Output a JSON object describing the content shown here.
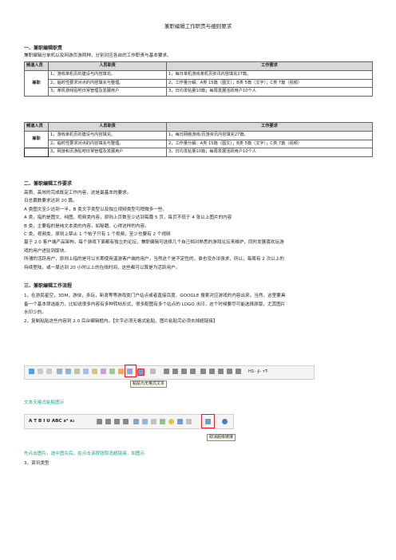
{
  "doc_title": "兼职编辑工作职责与细则要求",
  "s1": {
    "heading": "一、兼职编辑职责",
    "intro": "兼职编辑分单机以及网游页游两种，分别对应各自的工作职责与基本要求。",
    "table1": {
      "col1": "频道人员",
      "col2": "人员职责",
      "col3": "工作要求",
      "label": "兼职",
      "duties": [
        "1，游戏单机页的建设与内容填充。",
        "2，临时性要求对点的内容填充与整理。",
        "3，单机游戏贴吧日常管理及发展用户"
      ],
      "reqs": [
        "1，每日单机游戏单机页资讯内容填充27篇。",
        "2，工作量分解：A类 15篇（图文）；B类 5篇（文字）；C类 7篇（视频）",
        "3，日均发帖量10篇；每周发展活跃用户10个人"
      ]
    },
    "table2": {
      "col1": "频道人员",
      "col2": "人员职责",
      "col3": "工作要求",
      "label": "兼职",
      "duties": [
        "1，游戏单机页的建设与内容填充。",
        "2，临时性要求对点的内容填充与整理。",
        "3，网游和页游贴吧日常管理及发展用户"
      ],
      "reqs": [
        "1，每日网络游戏/页游资讯内容填充27篇。",
        "2，工作量分解：A类 15篇（图文）；B类 5篇（文字）；C类 7篇（视频）",
        "3，日均发帖量10篇；每周发展活跃用户10个人"
      ]
    }
  },
  "s2": {
    "heading": "二、兼职编辑工作要求",
    "lines": [
      "高质、高效的完成既定工作内容，这是最基本的要求。",
      "日总篇数要求达到 20 篇。",
      "A 类图文至少达到一半，B 类文字类型以及独立视频类型可稍微多一些。",
      "A 类，指的是图文、纯图、视频类内容，原则上页数至少达到每篇 5 页，每页不低于 4 张以上图片的内容",
      "B 类，主要指的是纯文本类的内容，如秘籍、心得这样的内容。",
      "C 类，视频类，原则上禁止 1 个帖子只有 1 个视频，至少也要有 2 个视频",
      "基于 2.0 客户端产品架构，每个游戏下面都有独立的论坛，兼职编辑可选择几个自己相对熟悉的游戏论坛来维护，同时发展喜欢玩游",
      "戏的用户进驻到版块。",
      "所谓的活跃用户，原则上指的是可以长期使用温游客户端的用户，当然这个是不定性的，谁也没办法强求，所以，每周有 2 次以上的",
      "持续登陆，或一周达到 20 小时以上的在线时间，这些都可以算是为活跃用户。"
    ]
  },
  "s3": {
    "heading": "三、兼职编辑工作流程",
    "lines": [
      "1，在游民星空，3DM，游侠，多玩，新浪等等游戏类门户站点或者直接百度、GOOGLE 搜索对应游戏的内容出来。当然，这里要具",
      "备一个基本筛选能力，比如说很多内容有多种转帖形式，很多配图有多个站点的 LOGO 水印，这个时候要尽可能选择原版，尤其图片",
      "水印少的。",
      "2，复制粘贴这些内容到 2.0 后台编辑框内。【文字必须无格式粘贴、图片粘贴完必须去掉超链接】"
    ],
    "tooltip1": "粘贴为无格式文本",
    "caption1": "文本无格式粘贴图示",
    "tooltip2": "取消超级链接",
    "caption2": "先点击图片，选中图片后，在点击该按钮取消超链接，如图示",
    "step3": "3，资讯类型"
  },
  "toolbar1_extra": "H1- ∮- ᴛT-",
  "toolbar2_extra": "A T B I U ABC x² x₂",
  "colors": {
    "accent_red": "#e02020",
    "caption_teal": "#1aa38c",
    "table_header": "#d9d9d9"
  }
}
